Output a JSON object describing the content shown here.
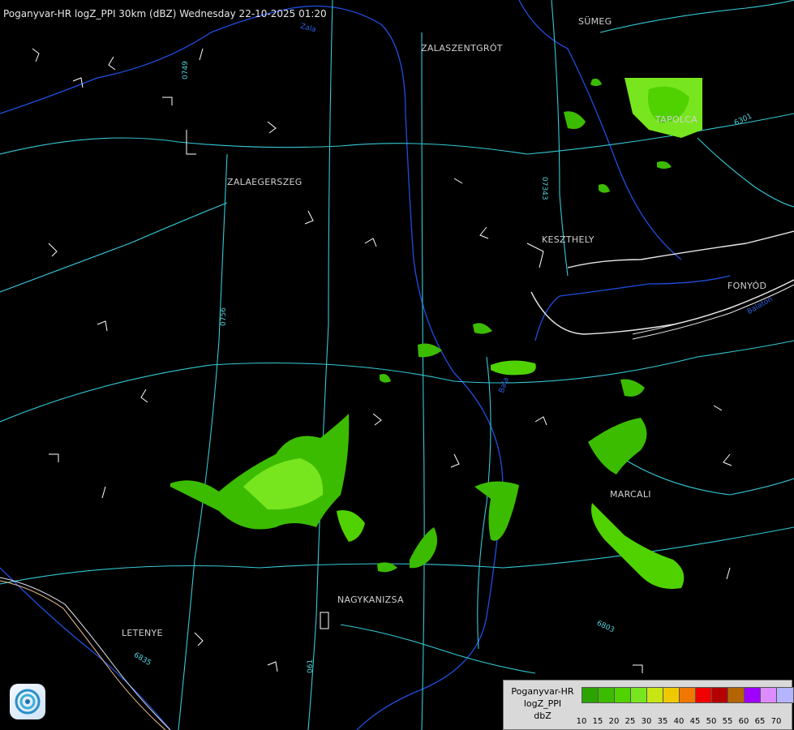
{
  "header": {
    "title": "Poganyvar-HR logZ_PPI 30km (dBZ) Wednesday 22-10-2025 01:20"
  },
  "cities": [
    {
      "key": "sumeg",
      "name": "SÜMEG"
    },
    {
      "key": "zalaszentgrot",
      "name": "ZALASZENTGRÓT"
    },
    {
      "key": "tapolca",
      "name": "TAPOLCA"
    },
    {
      "key": "zalaegerszeg",
      "name": "ZALAEGERSZEG"
    },
    {
      "key": "keszthely",
      "name": "KESZTHELY"
    },
    {
      "key": "fonyod",
      "name": "FONYÓD"
    },
    {
      "key": "marcali",
      "name": "MARCALI"
    },
    {
      "key": "nagykanizsa",
      "name": "NAGYKANIZSA"
    },
    {
      "key": "letenye",
      "name": "LETENYE"
    }
  ],
  "road_labels": [
    "0749",
    "07343",
    "0756",
    "6301",
    "6803",
    "6835",
    "061"
  ],
  "river_labels": [
    "Zala",
    "Balaton",
    "Bala"
  ],
  "legend": {
    "line1": "Poganyvar-HR",
    "line2": "logZ_PPI",
    "line3": "dbZ",
    "colors": [
      "#2ca400",
      "#3cbc00",
      "#50d200",
      "#78e61e",
      "#c8e614",
      "#f0c800",
      "#f07800",
      "#f00000",
      "#b40000",
      "#b46400",
      "#a000ff",
      "#dc8cff",
      "#b4b4ff"
    ],
    "labels": [
      "10",
      "15",
      "20",
      "25",
      "30",
      "35",
      "40",
      "45",
      "50",
      "55",
      "60",
      "65",
      "70"
    ]
  },
  "colors": {
    "borders": "#ffffff",
    "roads": "#35c9d6",
    "rivers": "#1f4fe0",
    "echo": "#55c83a"
  }
}
